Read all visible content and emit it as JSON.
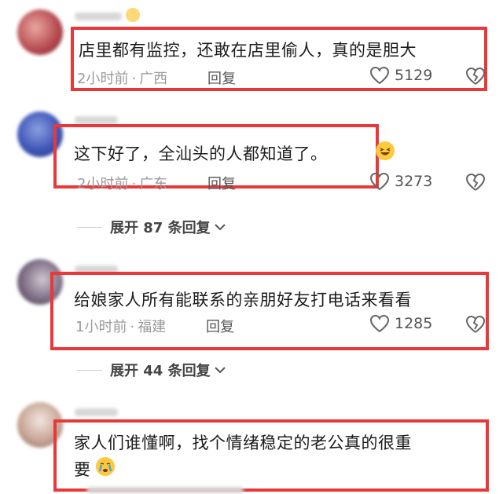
{
  "comments": [
    {
      "text": "店里都有监控，还敢在店里偷人，真的是胆大",
      "time": "2小时前",
      "location": "广西",
      "reply": "回复",
      "likes": "5129"
    },
    {
      "text": "这下好了，全汕头的人都知道了。",
      "time": "2小时前",
      "location": "广东",
      "reply": "回复",
      "likes": "3273"
    },
    {
      "text": "给娘家人所有能联系的亲朋好友打电话来看看",
      "time": "1小时前",
      "location": "福建",
      "reply": "回复",
      "likes": "1285"
    },
    {
      "text_line1": "家人们谁懂啊，找个情绪稳定的老公真的很重",
      "text_line2": "要"
    }
  ],
  "expand1": {
    "label": "展开 87 条回复"
  },
  "expand2": {
    "label": "展开 44 条回复"
  },
  "dot": "·",
  "colors": {
    "highlight_box": "#e8383a",
    "meta": "#9a9a9a"
  },
  "icons": [
    "heart-icon",
    "broken-heart-icon",
    "chevron-down-icon",
    "laughing-emoji-icon",
    "crying-emoji-icon"
  ]
}
